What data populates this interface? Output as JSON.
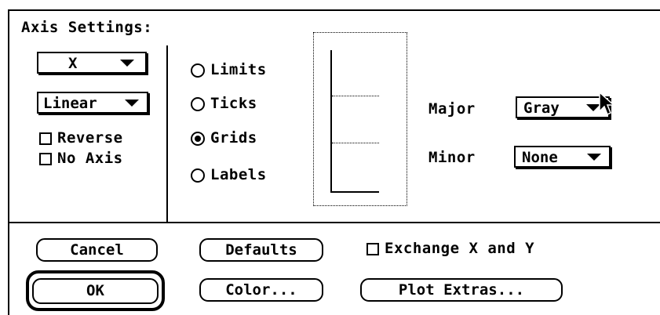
{
  "dialog": {
    "title": "Axis Settings:"
  },
  "axis_select": {
    "value": "X"
  },
  "scale_select": {
    "value": "Linear"
  },
  "options": {
    "reverse_label": "Reverse",
    "reverse_checked": false,
    "no_axis_label": "No Axis",
    "no_axis_checked": false
  },
  "modes": [
    {
      "label": "Limits",
      "selected": false
    },
    {
      "label": "Ticks",
      "selected": false
    },
    {
      "label": "Grids",
      "selected": true
    },
    {
      "label": "Labels",
      "selected": false
    }
  ],
  "grid_settings": {
    "major_label": "Major",
    "major_value": "Gray",
    "minor_label": "Minor",
    "minor_value": "None"
  },
  "buttons": {
    "cancel": "Cancel",
    "defaults": "Defaults",
    "ok": "OK",
    "color": "Color...",
    "plot_extras": "Plot Extras..."
  },
  "exchange": {
    "label": "Exchange X and Y",
    "checked": false
  },
  "icons": {
    "popup_arrow": "triangle-down-icon",
    "cursor": "arrow-cursor-icon"
  },
  "colors": {
    "foreground": "#000000",
    "background": "#ffffff"
  }
}
